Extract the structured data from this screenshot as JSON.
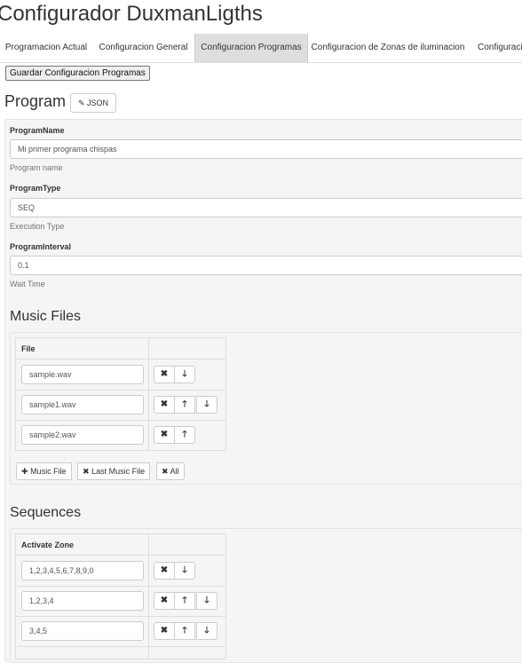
{
  "app_title": "Configurador DuxmanLigths",
  "tabs": [
    {
      "label": "Programacion Actual",
      "active": false
    },
    {
      "label": "Configuracion General",
      "active": false
    },
    {
      "label": "Configuracion Programas",
      "active": true
    },
    {
      "label": "Configuracion de Zonas de iluminacion",
      "active": false
    },
    {
      "label": "Configuracio",
      "active": false
    }
  ],
  "toolbar": {
    "save_label": "Guardar Configuracion Programas"
  },
  "program": {
    "heading": "Program",
    "json_button": "JSON",
    "fields": [
      {
        "label": "ProgramName",
        "value": "Mi primer programa chispas",
        "help": "Program name"
      },
      {
        "label": "ProgramType",
        "value": "SEQ",
        "help": "Execution Type"
      },
      {
        "label": "ProgramInterval",
        "value": "0.1",
        "help": "Wait Time"
      }
    ]
  },
  "music_files": {
    "heading": "Music Files",
    "column": "File",
    "rows": [
      "sample.wav",
      "sample1.wav",
      "sample2.wav"
    ],
    "add_label": "Music File",
    "remove_last_label": "Last Music File",
    "remove_all_label": "All"
  },
  "sequences": {
    "heading": "Sequences",
    "column": "Activate Zone",
    "rows": [
      "1,2,3,4,5,6,7,8,9,0",
      "1,2,3,4",
      "3,4,5"
    ]
  },
  "icons": {
    "remove": "✖",
    "up": "🡑",
    "down": "🡓",
    "plus": "✚",
    "pencil": "✎"
  }
}
